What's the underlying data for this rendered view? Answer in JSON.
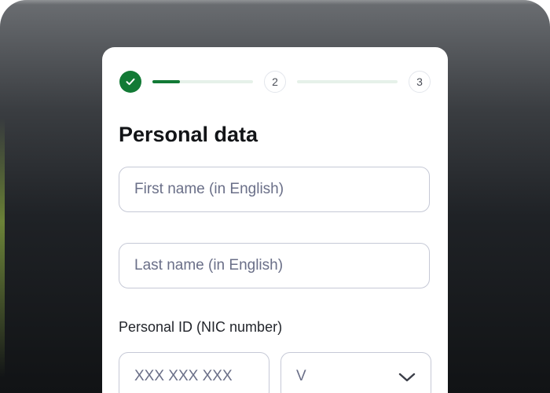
{
  "stepper": {
    "steps": [
      {
        "label": "",
        "state": "completed",
        "icon": "check-icon"
      },
      {
        "label": "2",
        "state": "pending"
      },
      {
        "label": "3",
        "state": "pending"
      }
    ],
    "current_progress": 0.27,
    "colors": {
      "done": "#127a35",
      "track": "#e6f1e9"
    }
  },
  "form": {
    "title": "Personal data",
    "first_name": {
      "placeholder": "First name (in English)",
      "value": ""
    },
    "last_name": {
      "placeholder": "Last name (in English)",
      "value": ""
    },
    "personal_id": {
      "label": "Personal ID (NIC number)",
      "number_placeholder": "XXX XXX XXX",
      "suffix_value": "V",
      "suffix_icon": "chevron-down-icon"
    }
  }
}
